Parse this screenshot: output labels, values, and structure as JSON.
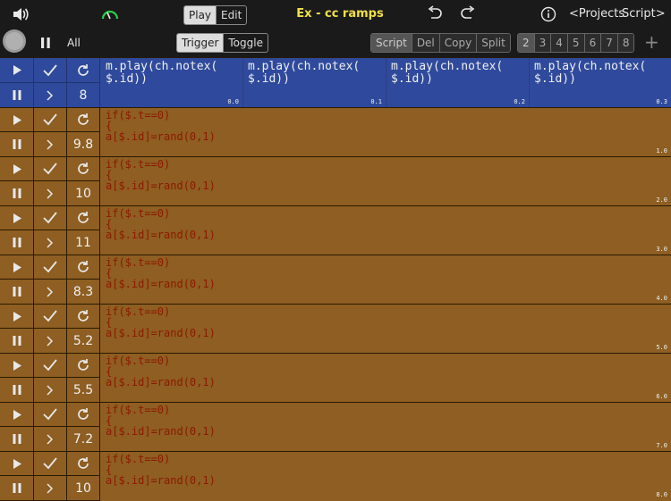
{
  "topbar": {
    "play_label": "Play",
    "edit_label": "Edit",
    "title": "Ex - cc ramps",
    "projects_label": "<Projects",
    "script_label": "Script>"
  },
  "subbar": {
    "all_label": "All",
    "trigger_label": "Trigger",
    "toggle_label": "Toggle",
    "script_label": "Script",
    "del_label": "Del",
    "copy_label": "Copy",
    "split_label": "Split",
    "pages": [
      "2",
      "3",
      "4",
      "5",
      "6",
      "7",
      "8"
    ],
    "plus": "+"
  },
  "header_row": {
    "number": "8",
    "columns": [
      {
        "code": "m.play(ch.notex(\n$.id))",
        "value": "0.0"
      },
      {
        "code": "m.play(ch.notex(\n$.id))",
        "value": "0.1"
      },
      {
        "code": "m.play(ch.notex(\n$.id))",
        "value": "0.2"
      },
      {
        "code": "m.play(ch.notex(\n$.id))",
        "value": "0.3"
      }
    ]
  },
  "rows": [
    {
      "number": "9.8",
      "code": "if($.t==0)\n{\na[$.id]=rand(0,1)",
      "value": "1.0"
    },
    {
      "number": "10",
      "code": "if($.t==0)\n{\na[$.id]=rand(0,1)",
      "value": "2.0"
    },
    {
      "number": "11",
      "code": "if($.t==0)\n{\na[$.id]=rand(0,1)",
      "value": "3.0"
    },
    {
      "number": "8.3",
      "code": "if($.t==0)\n{\na[$.id]=rand(0,1)",
      "value": "4.0"
    },
    {
      "number": "5.2",
      "code": "if($.t==0)\n{\na[$.id]=rand(0,1)",
      "value": "5.0"
    },
    {
      "number": "5.5",
      "code": "if($.t==0)\n{\na[$.id]=rand(0,1)",
      "value": "6.0"
    },
    {
      "number": "7.2",
      "code": "if($.t==0)\n{\na[$.id]=rand(0,1)",
      "value": "7.0"
    },
    {
      "number": "10",
      "code": "if($.t==0)\n{\na[$.id]=rand(0,1)",
      "value": "8.0"
    }
  ],
  "colors": {
    "header_bg": "#2f4a9c",
    "row_bg": "#8e5e22",
    "code_text": "#8b1a00",
    "title": "#f2e045",
    "gauge": "#2bd14b"
  }
}
